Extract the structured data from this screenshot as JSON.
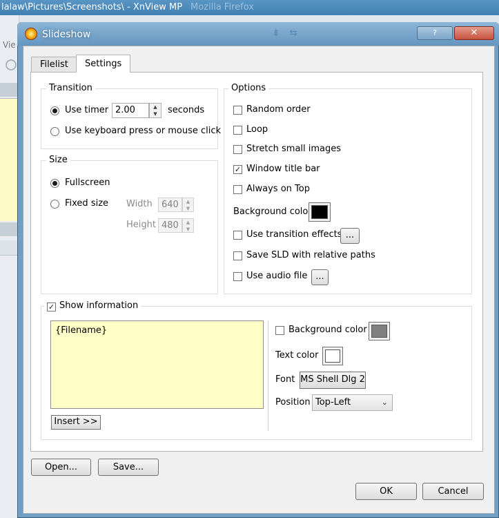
{
  "background": {
    "window_title": "lalaw\\Pictures\\Screenshots\\ - XnView MP",
    "ghost_title": "Mozilla Firefox",
    "menu_stub": "Vie"
  },
  "dialog": {
    "title": "Slideshow",
    "help_label": "?",
    "close_label": "✕"
  },
  "tabs": [
    {
      "label": "Filelist",
      "active": false
    },
    {
      "label": "Settings",
      "active": true
    }
  ],
  "transition": {
    "label": "Transition",
    "use_timer_label": "Use timer",
    "timer_value": "2.00",
    "seconds_label": "seconds",
    "keyboard_label": "Use keyboard press or mouse click",
    "selected": "timer"
  },
  "size": {
    "label": "Size",
    "fullscreen_label": "Fullscreen",
    "fixed_label": "Fixed size",
    "width_label": "Width",
    "width_value": "640",
    "height_label": "Height",
    "height_value": "480",
    "selected": "fullscreen"
  },
  "options": {
    "label": "Options",
    "random_order": {
      "label": "Random order",
      "checked": false
    },
    "loop": {
      "label": "Loop",
      "checked": false
    },
    "stretch": {
      "label": "Stretch small images",
      "checked": false
    },
    "window_title_bar": {
      "label": "Window title bar",
      "checked": true
    },
    "always_on_top": {
      "label": "Always on Top",
      "checked": false
    },
    "background_color_label": "Background color",
    "background_color": "#000000",
    "transition_effects": {
      "label": "Use transition effects",
      "checked": false
    },
    "save_sld": {
      "label": "Save SLD with relative paths",
      "checked": false
    },
    "audio_file": {
      "label": "Use audio file",
      "checked": false
    },
    "browse_label": "..."
  },
  "info": {
    "label": "Show information",
    "checked": true,
    "text": "{Filename}",
    "insert_label": "Insert >>",
    "bg_color": {
      "label": "Background color",
      "checked": false,
      "color": "#808080"
    },
    "text_color_label": "Text color",
    "text_color": "#ffffff",
    "font_label": "Font",
    "font_value": "MS Shell Dlg 2",
    "position_label": "Position",
    "position_value": "Top-Left"
  },
  "footer": {
    "open_label": "Open...",
    "save_label": "Save...",
    "ok_label": "OK",
    "cancel_label": "Cancel"
  }
}
